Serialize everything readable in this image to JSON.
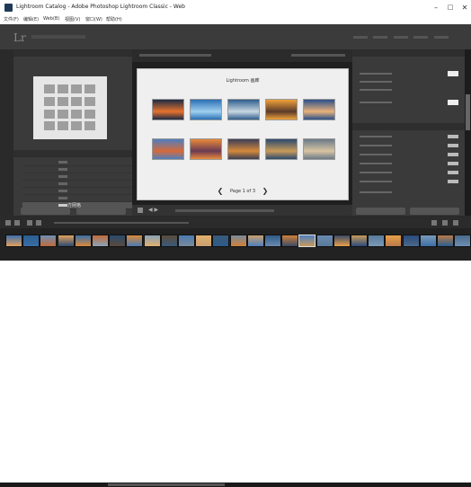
{
  "window": {
    "title": "Lightroom Catalog - Adobe Photoshop Lightroom Classic - Web",
    "minimize": "–",
    "maximize": "□",
    "close": "✕"
  },
  "menubar": {
    "items": [
      "文件(F)",
      "编辑(E)",
      "Web(B)",
      "视图(V)",
      "窗口(W)",
      "帮助(H)"
    ]
  },
  "identity": {
    "logo": "Lr"
  },
  "left_panel": {
    "templates": [
      {
        "label": ""
      },
      {
        "label": ""
      },
      {
        "label": ""
      },
      {
        "label": ""
      },
      {
        "label": ""
      },
      {
        "label": ""
      },
      {
        "label": "方网格"
      }
    ],
    "selected_index": 6
  },
  "gallery": {
    "title": "Lightroom 画廊",
    "page_label": "Page 1 of 3",
    "prev_arrow": "❮",
    "next_arrow": "❯",
    "thumb_colors": [
      [
        "#1c2b44",
        "#e7722e"
      ],
      [
        "#2b6fb5",
        "#9fd0ee"
      ],
      [
        "#2f5d8c",
        "#c8d7e2"
      ],
      [
        "#f0a23a",
        "#5a3a2a"
      ],
      [
        "#2a4f8a",
        "#e9b27a"
      ],
      [
        "#4f7fbf",
        "#d66a3a"
      ],
      [
        "#e98a3a",
        "#6b3a52"
      ],
      [
        "#3d3d55",
        "#d48a3a"
      ],
      [
        "#2b4a6e",
        "#c99a5a"
      ],
      [
        "#6a7a88",
        "#d8c4a2"
      ]
    ]
  },
  "toolbar": {
    "nav": "◀ ▶"
  },
  "filmstrip": {
    "selected_index": 17,
    "thumb_colors": [
      "#3e6fa9",
      "#2a5d8f",
      "#6d8fb5",
      "#e0a060",
      "#3a6ea5",
      "#c06a3a",
      "#2b4a6e",
      "#d98a3a",
      "#8aa3b8",
      "#5a4a3a",
      "#4a7ab0",
      "#e0b070",
      "#3a5a7a",
      "#7a8a9a",
      "#c8a070",
      "#2e5a88",
      "#d0803a",
      "#4f7fbf",
      "#6a8ab0",
      "#3a4a66",
      "#c89a5a",
      "#5a7a9a",
      "#e8a04a",
      "#2a4a7a",
      "#7a9ab8",
      "#b87a4a",
      "#4a6a8a"
    ]
  }
}
